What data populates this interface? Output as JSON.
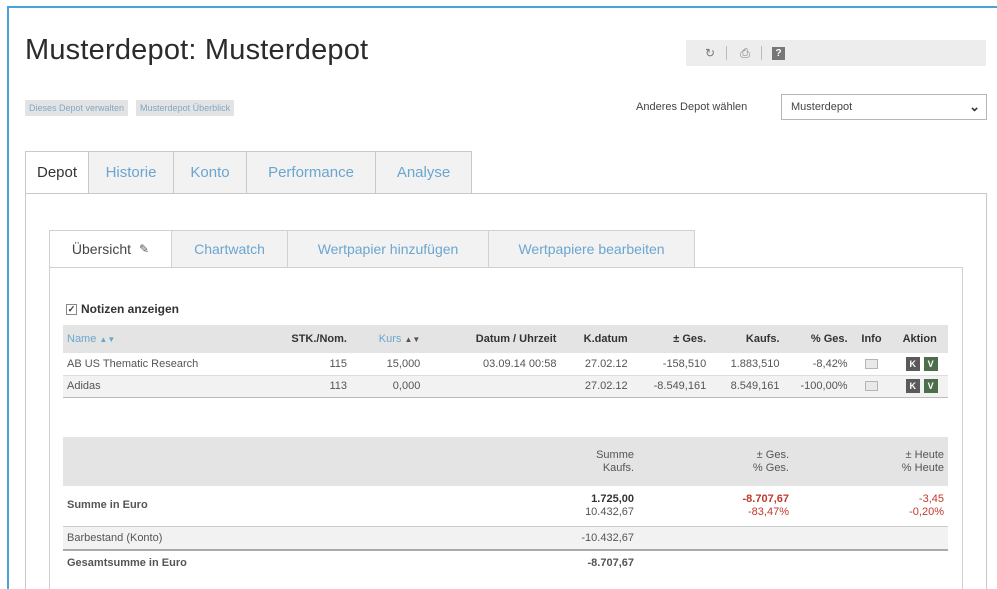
{
  "page": {
    "title": "Musterdepot: Musterdepot"
  },
  "toolbar": {
    "icons": [
      "refresh-icon",
      "print-icon",
      "help-icon"
    ]
  },
  "links": {
    "manage": "Dieses Depot verwalten",
    "overview": "Musterdepot Überblick"
  },
  "depot_select": {
    "label": "Anderes Depot wählen",
    "value": "Musterdepot"
  },
  "main_tabs": [
    "Depot",
    "Historie",
    "Konto",
    "Performance",
    "Analyse"
  ],
  "sub_tabs": [
    "Übersicht",
    "Chartwatch",
    "Wertpapier hinzufügen",
    "Wertpapiere bearbeiten"
  ],
  "notes": {
    "label": "Notizen anzeigen",
    "checked": true
  },
  "positions": {
    "headers": [
      "Name",
      "STK./Nom.",
      "Kurs",
      "Datum / Uhrzeit",
      "K.datum",
      "± Ges.",
      "Kaufs.",
      "% Ges.",
      "Info",
      "Aktion"
    ],
    "rows": [
      {
        "name": "AB US Thematic Research",
        "stk": "115",
        "kurs": "15,000",
        "datum": "03.09.14 00:58",
        "kdatum": "27.02.12",
        "ges": "-158,510",
        "kaufs": "1.883,510",
        "pges": "-8,42%"
      },
      {
        "name": "Adidas",
        "stk": "113",
        "kurs": "0,000",
        "datum": "",
        "kdatum": "27.02.12",
        "ges": "-8.549,161",
        "kaufs": "8.549,161",
        "pges": "-100,00%"
      }
    ],
    "actions": {
      "k": "K",
      "v": "V"
    }
  },
  "summary": {
    "header": {
      "summe": "Summe",
      "kaufs": "Kaufs.",
      "ges": "± Ges.",
      "pges": "% Ges.",
      "heute": "± Heute",
      "pheute": "% Heute"
    },
    "summe_euro": {
      "label": "Summe in Euro",
      "summe": "1.725,00",
      "kaufs": "10.432,67",
      "ges": "-8.707,67",
      "pges": "-83,47%",
      "heute": "-3,45",
      "pheute": "-0,20%"
    },
    "barbestand": {
      "label": "Barbestand (Konto)",
      "value": "-10.432,67"
    },
    "gesamtsumme": {
      "label": "Gesamtsumme in Euro",
      "value": "-8.707,67"
    }
  },
  "colors": {
    "accent": "#6aa6cf",
    "negative": "#c0392b",
    "frame": "#4aa3d8"
  }
}
